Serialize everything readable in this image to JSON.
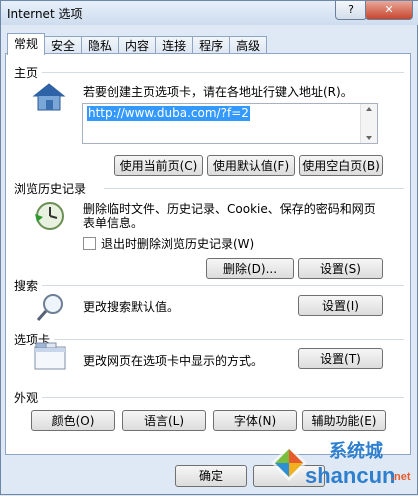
{
  "window": {
    "title": "Internet 选项",
    "help_label": "?",
    "close_label": "✕"
  },
  "tabs": [
    "常规",
    "安全",
    "隐私",
    "内容",
    "连接",
    "程序",
    "高级"
  ],
  "home": {
    "title": "主页",
    "description": "若要创建主页选项卡，请在各地址行键入地址(R)。",
    "url": "http://www.duba.com/?f=2",
    "btn_current": "使用当前页(C)",
    "btn_default": "使用默认值(F)",
    "btn_blank": "使用空白页(B)"
  },
  "history": {
    "title": "浏览历史记录",
    "description_line1": "删除临时文件、历史记录、Cookie、保存的密码和网页",
    "description_line2": "表单信息。",
    "checkbox_label": "退出时删除浏览历史记录(W)",
    "btn_delete": "删除(D)...",
    "btn_settings": "设置(S)"
  },
  "search": {
    "title": "搜索",
    "description": "更改搜索默认值。",
    "btn_settings": "设置(I)"
  },
  "tabs_section": {
    "title": "选项卡",
    "description": "更改网页在选项卡中显示的方式。",
    "btn_settings": "设置(T)"
  },
  "appearance": {
    "title": "外观",
    "btn_colors": "颜色(O)",
    "btn_languages": "语言(L)",
    "btn_fonts": "字体(N)",
    "btn_accessibility": "辅助功能(E)"
  },
  "footer": {
    "btn_ok": "确定"
  },
  "watermark": {
    "site": "shancun",
    "suffix": ".net",
    "brand": "系统城"
  }
}
